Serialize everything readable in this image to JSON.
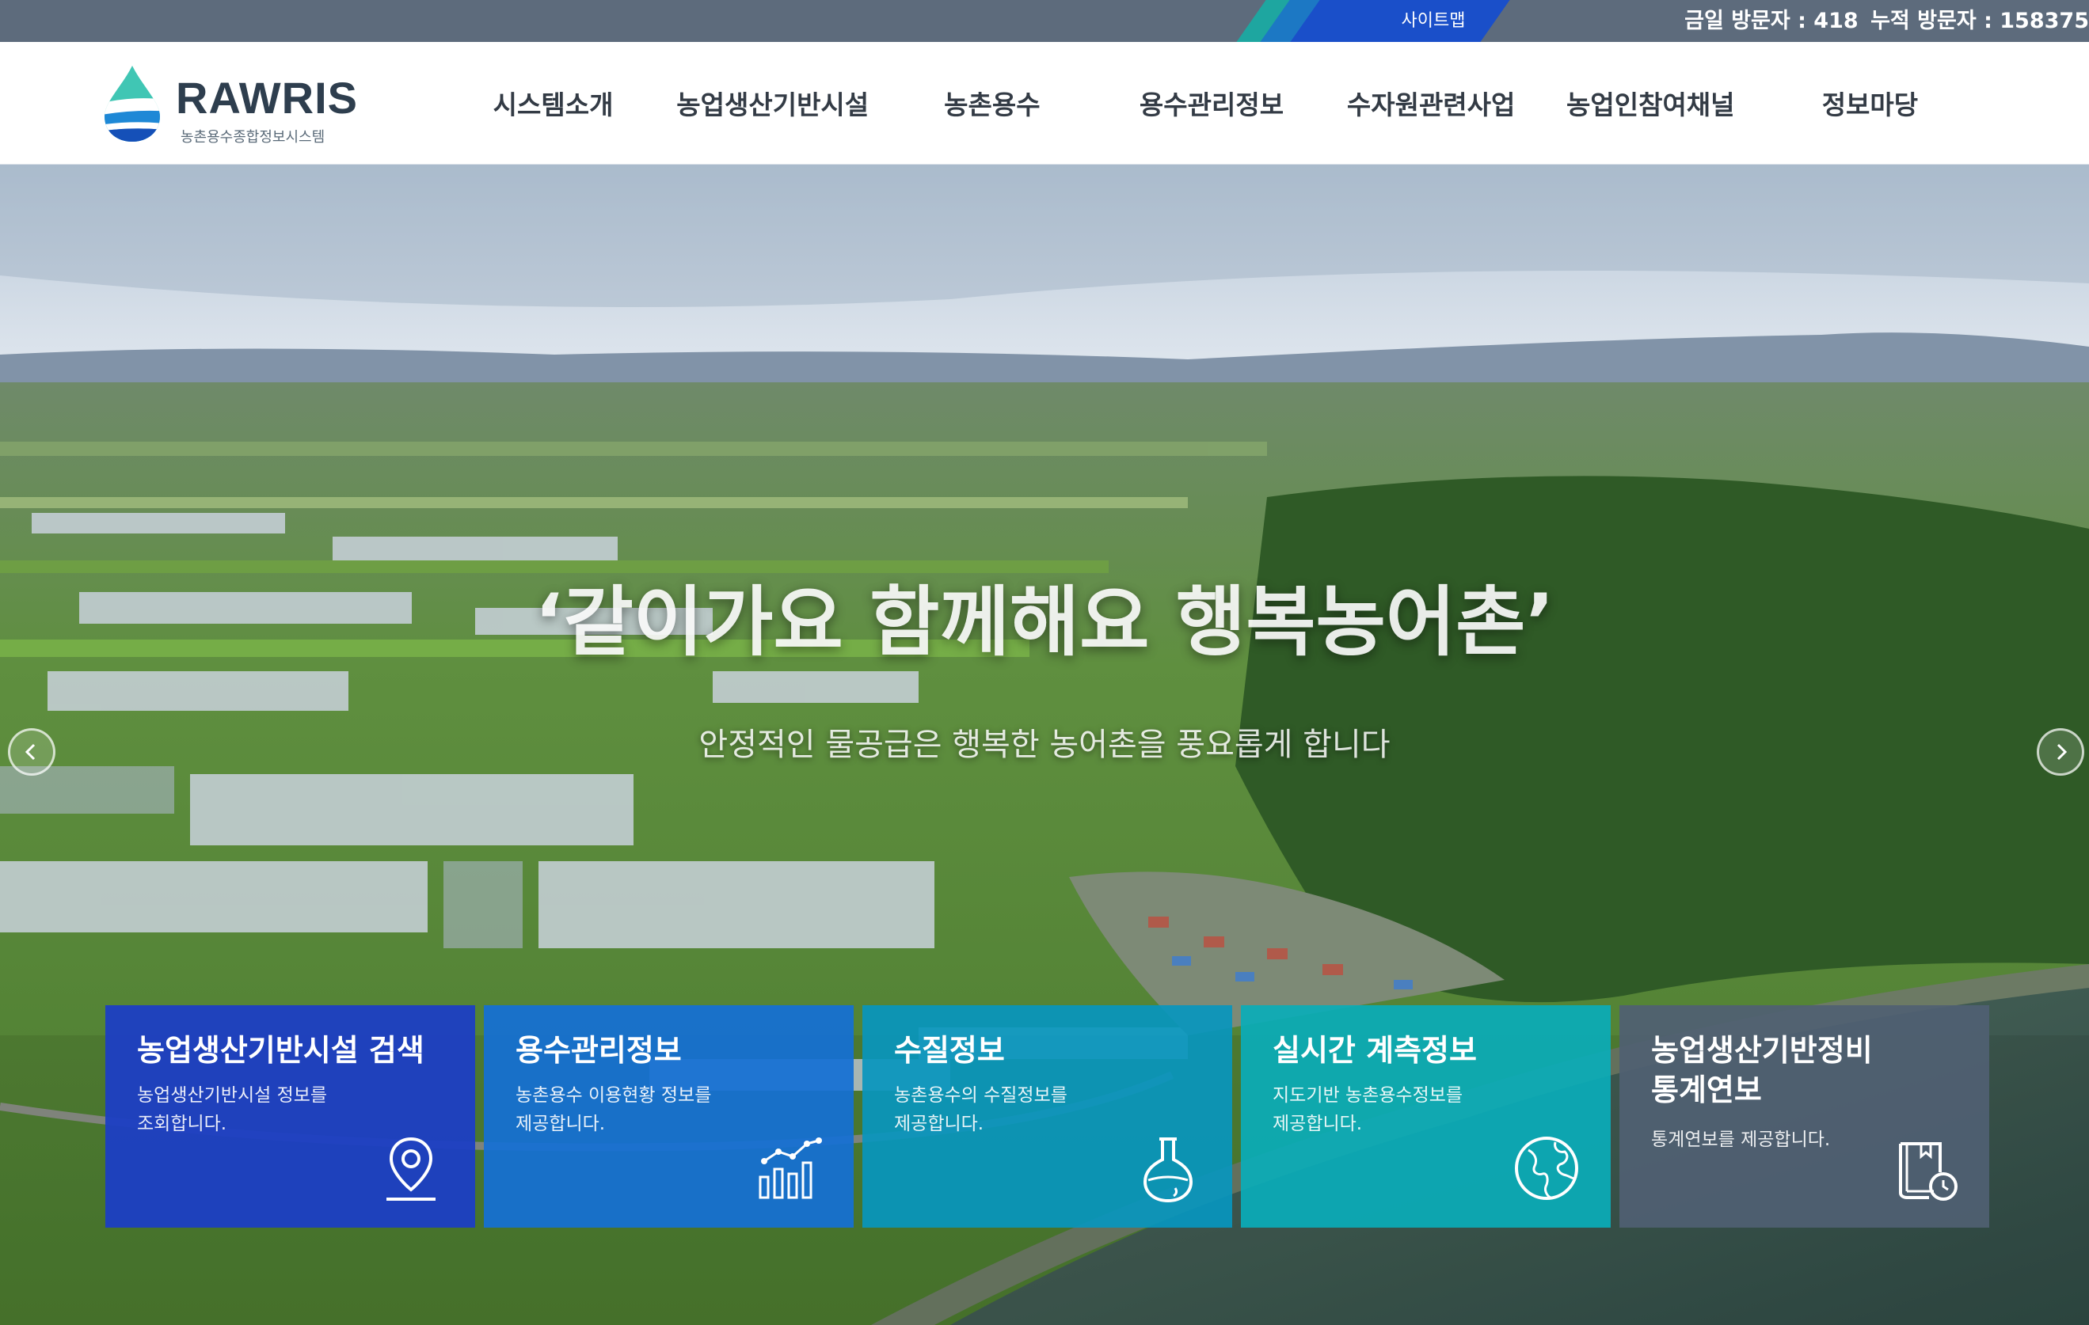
{
  "topbar": {
    "sitemap_label": "사이트맵",
    "visitors_today": "금일 방문자 : 418",
    "visitors_total": "누적 방문자 : 158375"
  },
  "header": {
    "logo_title": "RAWRIS",
    "logo_subtitle": "농촌용수종합정보시스템",
    "nav": [
      "시스템소개",
      "농업생산기반시설",
      "농촌용수",
      "용수관리정보",
      "수자원관련사업",
      "농업인참여채널",
      "정보마당"
    ]
  },
  "hero": {
    "title": "‘같이가요 함께해요 행복농어촌’",
    "subtitle": "안정적인 물공급은 행복한 농어촌을 풍요롭게 합니다"
  },
  "cards": [
    {
      "title": "농업생산기반시설 검색",
      "desc1": "농업생산기반시설 정보를",
      "desc2": "조회합니다.",
      "icon": "map-pin-icon"
    },
    {
      "title": "용수관리정보",
      "desc1": "농촌용수 이용현황 정보를",
      "desc2": "제공합니다.",
      "icon": "chart-icon"
    },
    {
      "title": "수질정보",
      "desc1": "농촌용수의 수질정보를",
      "desc2": "제공합니다.",
      "icon": "flask-icon"
    },
    {
      "title": "실시간 계측정보",
      "desc1": "지도기반 농촌용수정보를",
      "desc2": "제공합니다.",
      "icon": "globe-icon"
    },
    {
      "title1": "농업생산기반정비",
      "title2": "통계연보",
      "desc1": "통계연보를 제공합니다.",
      "icon": "book-clock-icon"
    }
  ],
  "colors": {
    "topbar": "#5d6b7c",
    "card1": "#1c3ec4",
    "card2": "#1470d4",
    "card3": "#0896be",
    "card4": "#0aacb8",
    "card5": "#506072"
  }
}
